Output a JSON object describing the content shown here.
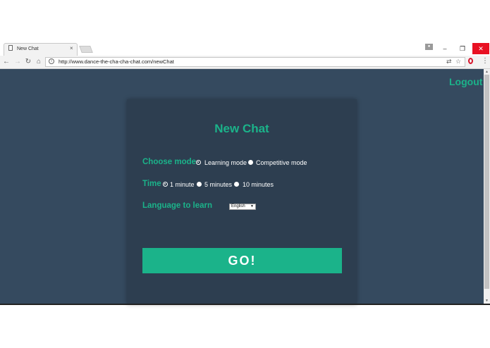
{
  "browser": {
    "tab_title": "New Chat",
    "tab_close": "×",
    "url": "http://www.dance-the-cha-cha-chat.com/newChat",
    "minimize": "–",
    "restore": "❐",
    "close": "✕",
    "back": "←",
    "forward": "→",
    "reload": "↻",
    "home": "⌂",
    "info": "i",
    "translate": "⇄",
    "star": "☆",
    "menu": "⋮"
  },
  "page": {
    "logout": "Logout",
    "title": "New Chat",
    "mode": {
      "label": "Choose mode",
      "options": [
        "Learning mode",
        "Competitive mode"
      ],
      "selected": "Learning mode"
    },
    "time": {
      "label": "Time",
      "options": [
        "1 minute",
        "5 minutes",
        "10 minutes"
      ],
      "selected": "1 minute"
    },
    "language": {
      "label": "Language to learn",
      "selected": "English"
    },
    "go": "GO!"
  },
  "colors": {
    "background": "#354a5f",
    "card": "#2d3e50",
    "accent": "#1bb38a"
  }
}
